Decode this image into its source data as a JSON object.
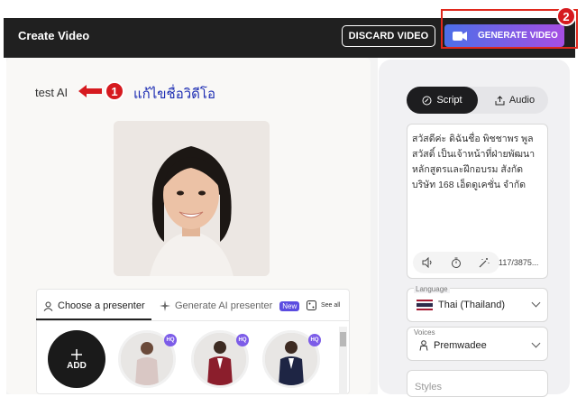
{
  "header": {
    "title": "Create Video",
    "discard_label": "DISCARD VIDEO",
    "generate_label": "GENERATE VIDEO"
  },
  "video": {
    "name": "test AI"
  },
  "annotations": {
    "step1_number": "1",
    "step1_text": "แก้ไขชื่อวิดีโอ",
    "step2_number": "2",
    "color": "#d61a1f"
  },
  "presenter": {
    "tab_choose": "Choose a presenter",
    "tab_generate": "Generate AI presenter",
    "new_badge": "New",
    "see_all": "See all",
    "add_label": "ADD",
    "hq_badge": "HQ"
  },
  "script_panel": {
    "tab_script": "Script",
    "tab_audio": "Audio",
    "text": "สวัสดีค่ะ ดิฉันชื่อ พิชชาพร พูล สวัสดิ์ เป็นเจ้าหน้าที่ฝ่ายพัฒนาหลักสูตรและฝึกอบรม สังกัด บริษัท 168 เอ็ดดูเคชั่น จำกัด",
    "char_count": "117/3875..."
  },
  "settings": {
    "language_label": "Language",
    "language_value": "Thai (Thailand)",
    "voices_label": "Voices",
    "voices_value": "Premwadee",
    "styles_label": "Styles"
  },
  "colors": {
    "topbar": "#202020",
    "accent_start": "#4c6fe8",
    "accent_end": "#a64ee3",
    "annotation_blue": "#1d2db3"
  }
}
